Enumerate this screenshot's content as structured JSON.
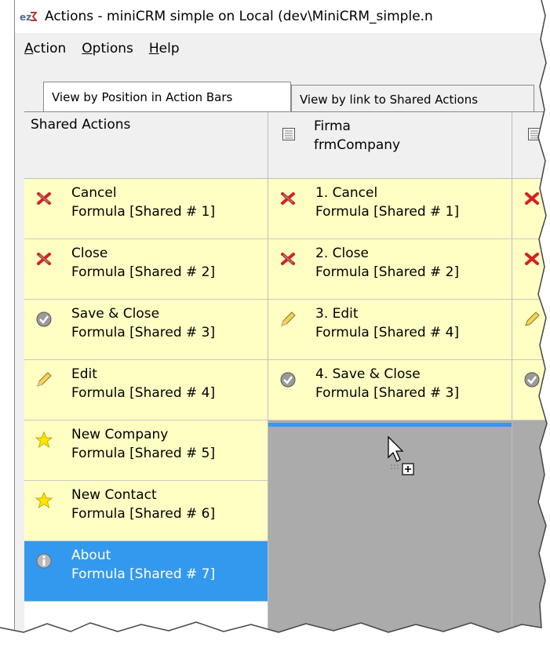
{
  "window": {
    "title": "Actions - miniCRM simple on Local (dev\\MiniCRM_simple.n"
  },
  "menu": [
    {
      "access_key": "A",
      "rest": "ction"
    },
    {
      "access_key": "O",
      "rest": "ptions"
    },
    {
      "access_key": "H",
      "rest": "elp"
    }
  ],
  "tabs": [
    {
      "label": "View by Position in Action Bars",
      "active": true
    },
    {
      "label": "View by link to Shared Actions",
      "active": false
    }
  ],
  "columns": {
    "shared": {
      "header": "Shared Actions"
    },
    "firma": {
      "name": "Firma",
      "form": "frmCompany"
    }
  },
  "shared_actions": [
    {
      "name": "Cancel",
      "formula": "Formula [Shared # 1]",
      "icon": "cancel-x-icon"
    },
    {
      "name": "Close",
      "formula": "Formula [Shared # 2]",
      "icon": "close-x-icon"
    },
    {
      "name": "Save & Close",
      "formula": "Formula [Shared # 3]",
      "icon": "checkmark-circle-icon"
    },
    {
      "name": "Edit",
      "formula": "Formula [Shared # 4]",
      "icon": "pencil-icon"
    },
    {
      "name": "New Company",
      "formula": "Formula [Shared # 5]",
      "icon": "star-icon"
    },
    {
      "name": "New Contact",
      "formula": "Formula [Shared # 6]",
      "icon": "star-icon"
    },
    {
      "name": "About",
      "formula": "Formula [Shared # 7]",
      "icon": "info-circle-icon",
      "selected": true
    }
  ],
  "firma_actions": [
    {
      "name": "1. Cancel",
      "formula": "Formula [Shared # 1]",
      "icon": "cancel-x-icon"
    },
    {
      "name": "2. Close",
      "formula": "Formula [Shared # 2]",
      "icon": "close-x-icon"
    },
    {
      "name": "3. Edit",
      "formula": "Formula [Shared # 4]",
      "icon": "pencil-icon"
    },
    {
      "name": "4. Save & Close",
      "formula": "Formula [Shared # 3]",
      "icon": "checkmark-circle-icon"
    }
  ],
  "colors": {
    "action_bg": "#ffffc4",
    "selected_bg": "#3399ee",
    "empty_bg": "#ababab",
    "drop_indicator": "#3399ee"
  }
}
